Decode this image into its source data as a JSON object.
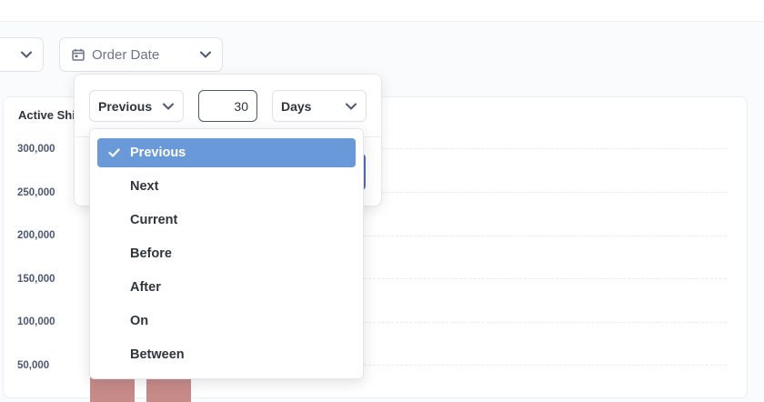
{
  "filters": {
    "order_date_label": "Order Date"
  },
  "chart": {
    "title": "Active Shi"
  },
  "date_filter": {
    "operator_label": "Previous",
    "amount_value": "30",
    "unit_label": "Days",
    "operator_options": [
      {
        "label": "Previous",
        "selected": true
      },
      {
        "label": "Next",
        "selected": false
      },
      {
        "label": "Current",
        "selected": false
      },
      {
        "label": "Before",
        "selected": false
      },
      {
        "label": "After",
        "selected": false
      },
      {
        "label": "On",
        "selected": false
      },
      {
        "label": "Between",
        "selected": false
      }
    ]
  },
  "colors": {
    "bar": "#c78b89",
    "selected_option": "#6a99d9",
    "accent_button": "#5c67ac"
  },
  "chart_data": {
    "type": "bar",
    "title": "Active Shi",
    "yticks": [
      "300,000",
      "250,000",
      "200,000",
      "150,000",
      "100,000",
      "50,000"
    ],
    "ylim": [
      0,
      300000
    ],
    "series": [
      {
        "values": [
          null,
          null
        ]
      }
    ],
    "grid": true
  }
}
